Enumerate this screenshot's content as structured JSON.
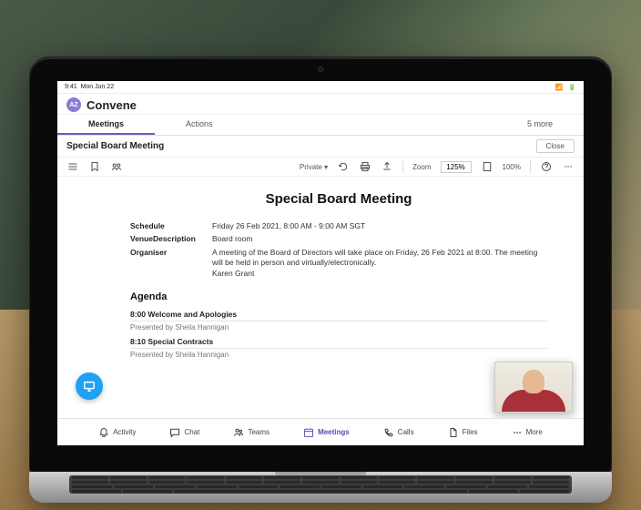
{
  "statusbar": {
    "time": "9:41",
    "date": "Mon Jun 22"
  },
  "app": {
    "avatar": "AZ",
    "name": "Convene"
  },
  "tabs": {
    "meetings": "Meetings",
    "actions": "Actions",
    "more": "5 more"
  },
  "titlebar": {
    "title": "Special Board Meeting",
    "close": "Close"
  },
  "toolbar": {
    "privacy": "Private",
    "zoom_label": "Zoom",
    "zoom_value": "125%",
    "onehundred": "100%"
  },
  "doc": {
    "heading": "Special Board Meeting",
    "schedule_k": "Schedule",
    "schedule_v": "Friday 26 Feb 2021, 8:00 AM - 9:00 AM SGT",
    "venue_k": "VenueDescription",
    "venue_v": "Board room",
    "desc_v": "A meeting of the Board of Directors will take place on Friday, 26 Feb 2021 at 8:00. The meeting will be held in person and virtually/electronically.",
    "organiser_k": "Organiser",
    "organiser_v": "Karen Grant",
    "agenda_h": "Agenda",
    "items": [
      {
        "title": "8:00 Welcome and Apologies",
        "presenter": "Presented by Sheila Hannigan"
      },
      {
        "title": "8:10 Special Contracts",
        "presenter": "Presented by Sheila Hannigan"
      }
    ]
  },
  "bottomnav": {
    "activity": "Activity",
    "chat": "Chat",
    "teams": "Teams",
    "meetings": "Meetings",
    "calls": "Calls",
    "files": "Files",
    "more": "More"
  }
}
